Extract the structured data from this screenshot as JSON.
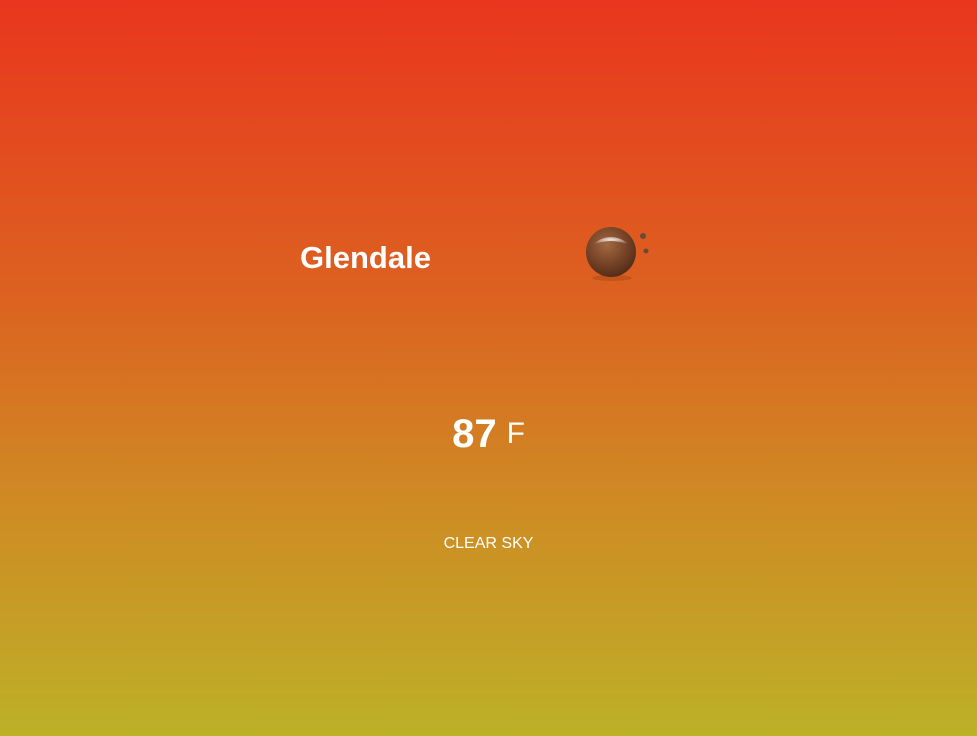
{
  "weather": {
    "city": "Glendale",
    "temperature": "87",
    "unit": "F",
    "description": "CLEAR SKY",
    "icon": "clear-sky-night-icon"
  },
  "colors": {
    "gradient_top": "#e9361e",
    "gradient_bottom": "#bcb127",
    "text": "#ffffff",
    "icon_body": "#7a4a2c"
  }
}
